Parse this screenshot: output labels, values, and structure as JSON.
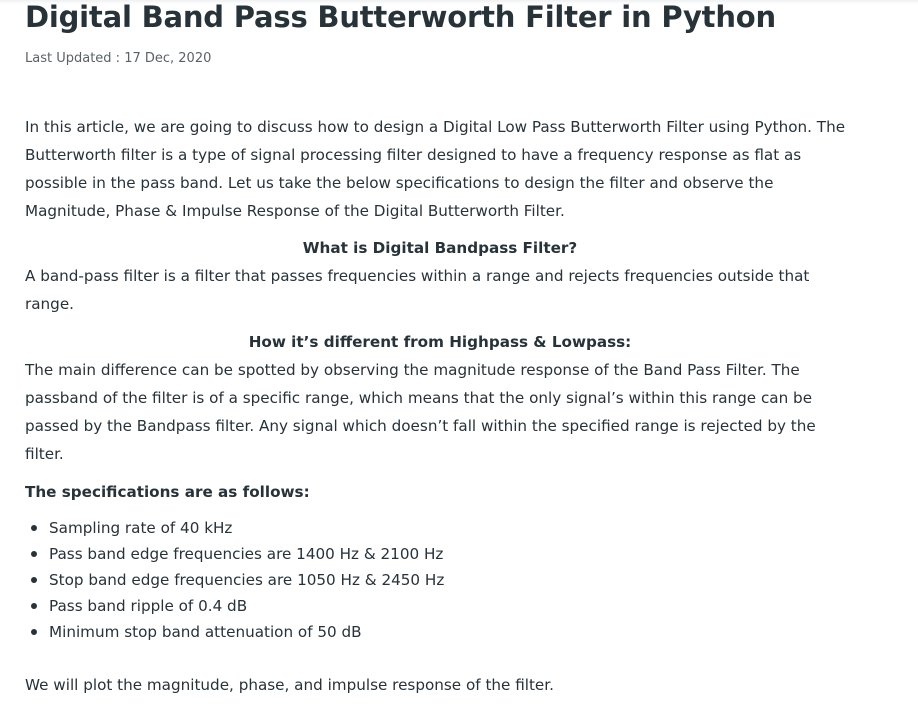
{
  "article": {
    "title": "Digital Band Pass Butterworth Filter in Python",
    "last_updated": "Last Updated : 17 Dec, 2020",
    "intro": "In this article, we are going to discuss how to design a Digital Low Pass Butterworth Filter using Python. The Butterworth filter is a type of signal processing filter designed to have a frequency response as flat as possible in the pass band. Let us take the below specifications to design the filter and observe the Magnitude, Phase & Impulse Response of the Digital Butterworth Filter.",
    "section1_heading": "What is Digital Bandpass Filter?",
    "section1_text": "A band-pass filter is a filter that passes frequencies within a range and rejects frequencies outside that range.",
    "section2_heading": "How it’s different from Highpass & Lowpass:",
    "section2_text": "The main difference can be spotted by observing the magnitude response of the Band Pass Filter. The passband of the filter is of a specific range, which means that the only signal’s within this range can be passed by the Bandpass filter. Any signal which doesn’t fall within the specified range is rejected by the filter.",
    "specs_heading": "The specifications are as follows:",
    "specs": [
      "Sampling rate of 40 kHz",
      "Pass band edge frequencies are 1400 Hz & 2100 Hz",
      "Stop band edge frequencies are 1050 Hz & 2450 Hz",
      "Pass band ripple of 0.4 dB",
      "Minimum stop band attenuation of 50 dB"
    ],
    "closing": "We will plot the magnitude, phase, and impulse response of the filter."
  }
}
